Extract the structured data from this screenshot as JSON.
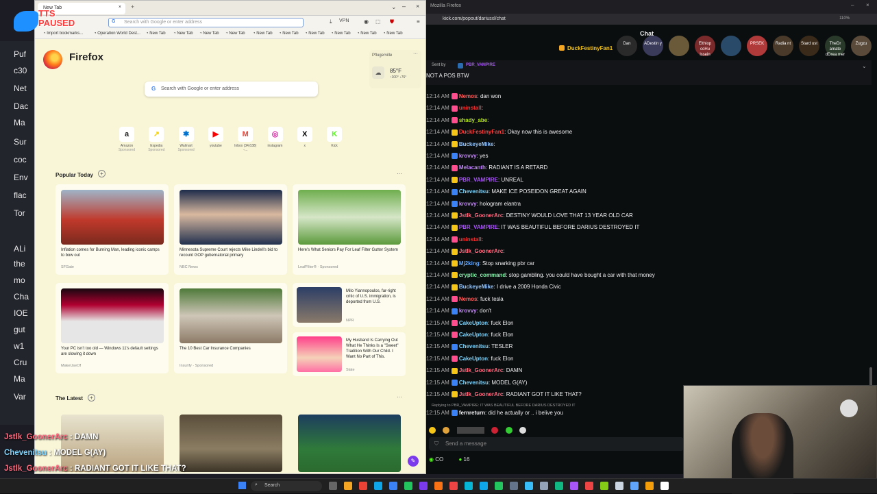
{
  "tts": {
    "top": "TTS",
    "bottom": "PAUSED"
  },
  "desktop_items": [
    "Puf",
    "c30",
    "Net",
    "Dac",
    "Ma",
    "Sur",
    "coc",
    "Env",
    "flac",
    "Tor",
    "ALi",
    "the",
    "mo",
    "Cha",
    "IOE",
    "gut",
    "w1",
    "Cru",
    "Ma",
    "Var"
  ],
  "firefox": {
    "tab_title": "New Tab",
    "url_placeholder": "Search with Google or enter address",
    "vpn": "VPN",
    "bookmarks": [
      "Import bookmarks...",
      "Operation World Dest...",
      "New Tab",
      "New Tab",
      "New Tab",
      "New Tab",
      "New Tab",
      "New Tab",
      "New Tab",
      "New Tab",
      "New Tab",
      "New Tab"
    ],
    "brand": "Firefox",
    "search_placeholder": "Search with Google or enter address",
    "weather": {
      "location": "Pflugerville",
      "temp": "85°F",
      "range": "↑100° ↓76°"
    },
    "shortcuts": [
      {
        "label": "Amazon",
        "sub": "Sponsored",
        "glyph": "a",
        "color": "#222"
      },
      {
        "label": "Expedia",
        "sub": "Sponsored",
        "glyph": "↗",
        "color": "#f5d000"
      },
      {
        "label": "Walmart",
        "sub": "Sponsored",
        "glyph": "✱",
        "color": "#0071ce"
      },
      {
        "label": "youtube",
        "sub": "",
        "glyph": "▶",
        "color": "#ff0000"
      },
      {
        "label": "Inbox (34,638) -...",
        "sub": "",
        "glyph": "M",
        "color": "#ea4335"
      },
      {
        "label": "instagram",
        "sub": "",
        "glyph": "◎",
        "color": "#d6249f"
      },
      {
        "label": "x",
        "sub": "",
        "glyph": "X",
        "color": "#000"
      },
      {
        "label": "Kick",
        "sub": "",
        "glyph": "K",
        "color": "#53fc18"
      }
    ],
    "popular_title": "Popular Today",
    "cards": [
      {
        "title": "Inflation comes for Burning Man, leading iconic camps to bow out",
        "source": "SFGate"
      },
      {
        "title": "Minnesota Supreme Court rejects Mike Lindell's bid to recount GOP gubernatorial primary",
        "source": "NBC News"
      },
      {
        "title": "Here's What Seniors Pay For Leaf Filter Gutter System",
        "source": "LeafFilter® · Sponsored"
      },
      {
        "title": "Your PC isn't too old — Windows 11's default settings are slowing it down",
        "source": "MakeUseOf"
      },
      {
        "title": "The 10 Best Car Insurance Companies",
        "source": "Insurify · Sponsored"
      }
    ],
    "hcards": [
      {
        "title": "Milo Yiannopoulos, far-right critic of U.S. immigration, is deported from U.S.",
        "source": "NPR"
      },
      {
        "title": "My Husband Is Carrying Out What He Thinks Is a \"Sweet\" Tradition With Our Child. I Want No Part of This.",
        "source": "Slate"
      }
    ],
    "latest_title": "The Latest"
  },
  "kick": {
    "window_title": "Mozilla Firefox",
    "address": "kick.com/popout/dariusxl/chat",
    "zoom": "110%",
    "chat_title": "Chat",
    "gifter": "DuckFestinyFan1",
    "top_chatters": [
      "Dan",
      "ADestin y",
      "",
      "Elthiop coHu lssein",
      "",
      "PRSEK",
      "Radia nt",
      "Stard ust",
      "TheDr amate dDrea mer",
      "Zugzu"
    ],
    "pinned_sender": "Sent by",
    "pinned_user": "PBR_VAMPIRE",
    "pinned_text": "NOT A POS BTW",
    "messages": [
      {
        "time": "12:14 AM",
        "user": "Nemos",
        "color": "#ff5c5c",
        "text": ": dan won"
      },
      {
        "time": "12:14 AM",
        "user": "uninstall",
        "color": "#ff2f2f",
        "text": ":"
      },
      {
        "time": "12:14 AM",
        "user": "shady_abe",
        "color": "#b5e61d",
        "text": ":"
      },
      {
        "time": "12:14 AM",
        "user": "DuckFestinyFan1",
        "color": "#ff3e3e",
        "text": ": Okay now this is awesome"
      },
      {
        "time": "12:14 AM",
        "user": "BuckeyeMike",
        "color": "#93c5fd",
        "text": ":"
      },
      {
        "time": "12:14 AM",
        "user": "krovvy",
        "color": "#c58af9",
        "text": ": yes"
      },
      {
        "time": "12:14 AM",
        "user": "Melacanth",
        "color": "#c084fc",
        "text": ": RADIANT IS A RETARD"
      },
      {
        "time": "12:14 AM",
        "user": "PBR_VAMPIRE",
        "color": "#a855f7",
        "text": ": UNREAL"
      },
      {
        "time": "12:14 AM",
        "user": "Chevenitsu",
        "color": "#7dd3fc",
        "text": ": MAKE ICE POSEIDON GREAT AGAIN"
      },
      {
        "time": "12:14 AM",
        "user": "krovvy",
        "color": "#c58af9",
        "text": ": hologram elantra"
      },
      {
        "time": "12:14 AM",
        "user": "Jstlk_GoonerArc",
        "color": "#ff6b81",
        "text": ": DESTINY WOULD LOVE THAT 13 YEAR OLD CAR"
      },
      {
        "time": "12:14 AM",
        "user": "PBR_VAMPIRE",
        "color": "#a855f7",
        "text": ": IT WAS BEAUTIFUL BEFORE DARIUS DESTROYED IT"
      },
      {
        "time": "12:14 AM",
        "user": "uninstall",
        "color": "#ff2f2f",
        "text": ":"
      },
      {
        "time": "12:14 AM",
        "user": "Jstlk_GoonerArc",
        "color": "#ff6b81",
        "text": ":"
      },
      {
        "time": "12:14 AM",
        "user": "Mj2king",
        "color": "#60a5fa",
        "text": ": Stop snarking pbr car"
      },
      {
        "time": "12:14 AM",
        "user": "cryptic_command",
        "color": "#86efac",
        "text": ": stop gambling. you could have bought a car with that money"
      },
      {
        "time": "12:14 AM",
        "user": "BuckeyeMike",
        "color": "#93c5fd",
        "text": ": I drive a 2009 Honda Civic"
      },
      {
        "time": "12:14 AM",
        "user": "Nemos",
        "color": "#ff5c5c",
        "text": ": fuck tesla"
      },
      {
        "time": "12:14 AM",
        "user": "krovvy",
        "color": "#c58af9",
        "text": ": don't"
      },
      {
        "time": "12:15 AM",
        "user": "CakeUpton",
        "color": "#7dd3fc",
        "text": ": fuck Elon"
      },
      {
        "time": "12:15 AM",
        "user": "CakeUpton",
        "color": "#7dd3fc",
        "text": ": fuck Elon"
      },
      {
        "time": "12:15 AM",
        "user": "Chevenitsu",
        "color": "#7dd3fc",
        "text": ": TESLER"
      },
      {
        "time": "12:15 AM",
        "user": "CakeUpton",
        "color": "#7dd3fc",
        "text": ": fuck Elon"
      },
      {
        "time": "12:15 AM",
        "user": "Jstlk_GoonerArc",
        "color": "#ff6b81",
        "text": ": DAMN"
      },
      {
        "time": "12:15 AM",
        "user": "Chevenitsu",
        "color": "#7dd3fc",
        "text": ": MODEL G(AY)"
      },
      {
        "time": "12:15 AM",
        "user": "Jstlk_GoonerArc",
        "color": "#ff6b81",
        "text": ": RADIANT GOT IT LIKE THAT?"
      }
    ],
    "reply_context": "Replying to PBR_VAMPIRE: IT WAS BEAUTIFUL BEFORE DARIUS DESTROYED IT",
    "last_message": {
      "time": "12:15 AM",
      "user": "fernreturn",
      "color": "#efeff1",
      "text": ": did he actually or .. i belive you"
    },
    "input_placeholder": "Send a message",
    "footer_left": "CO",
    "footer_count": "16"
  },
  "overlay": [
    {
      "user": "Jstlk_GoonerArc",
      "color": "#ff6b81",
      "text": " : DAMN"
    },
    {
      "user": "Chevenitsu",
      "color": "#7dd3fc",
      "text": " : MODEL G(AY)"
    },
    {
      "user": "Jstlk_GoonerArc",
      "color": "#ff6b81",
      "text": " : RADIANT GOT IT LIKE THAT?"
    },
    {
      "user": "fernreturn",
      "color": "#ffffff",
      "text": " : did he actually or .. i belive you"
    }
  ],
  "taskbar": {
    "search": "Search"
  }
}
